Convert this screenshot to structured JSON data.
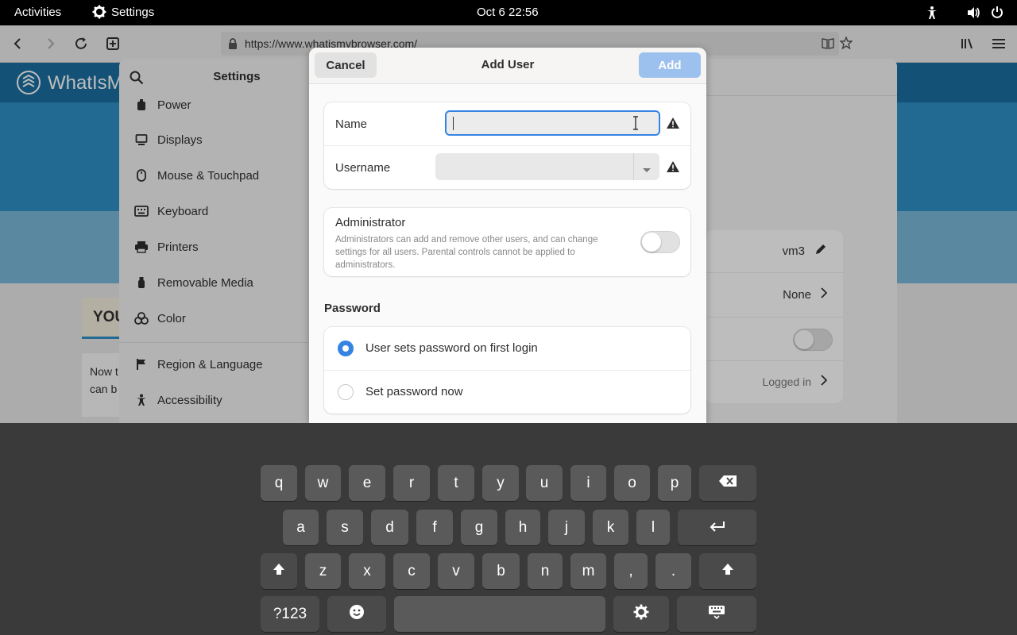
{
  "topbar": {
    "activities": "Activities",
    "app_name": "Settings",
    "datetime": "Oct 6  22:56"
  },
  "browser": {
    "url": "https://www.whatismybrowser.com/"
  },
  "website": {
    "logo_text": "WhatIsM",
    "box_text": "YOU",
    "text_line1": "Now t",
    "text_line2": "can b"
  },
  "settings": {
    "title": "Settings",
    "sidebar_items": [
      {
        "label": "Power",
        "icon": "power-icon"
      },
      {
        "label": "Displays",
        "icon": "display-icon"
      },
      {
        "label": "Mouse & Touchpad",
        "icon": "mouse-icon"
      },
      {
        "label": "Keyboard",
        "icon": "keyboard-icon"
      },
      {
        "label": "Printers",
        "icon": "printer-icon"
      },
      {
        "label": "Removable Media",
        "icon": "usb-icon"
      },
      {
        "label": "Color",
        "icon": "color-icon"
      },
      {
        "label": "Region & Language",
        "icon": "flag-icon"
      },
      {
        "label": "Accessibility",
        "icon": "accessibility-icon"
      }
    ],
    "user_card": {
      "name": "vm3",
      "parental": "None",
      "status": "Logged in"
    }
  },
  "dialog": {
    "cancel_label": "Cancel",
    "title": "Add User",
    "add_label": "Add",
    "name_label": "Name",
    "name_value": "",
    "username_label": "Username",
    "username_value": "",
    "admin_title": "Administrator",
    "admin_desc": "Administrators can add and remove other users, and can change settings for all users. Parental controls cannot be applied to administrators.",
    "admin_enabled": false,
    "password_heading": "Password",
    "password_options": [
      {
        "label": "User sets password on first login",
        "selected": true
      },
      {
        "label": "Set password now",
        "selected": false
      }
    ]
  },
  "keyboard": {
    "row1": [
      "q",
      "w",
      "e",
      "r",
      "t",
      "y",
      "u",
      "i",
      "o",
      "p"
    ],
    "row2": [
      "a",
      "s",
      "d",
      "f",
      "g",
      "h",
      "j",
      "k",
      "l"
    ],
    "row3": [
      "z",
      "x",
      "c",
      "v",
      "b",
      "n",
      "m",
      ",",
      "."
    ],
    "symbols_label": "?123"
  },
  "colors": {
    "accent": "#3584e4",
    "add_button_disabled": "#9cc1ee"
  }
}
